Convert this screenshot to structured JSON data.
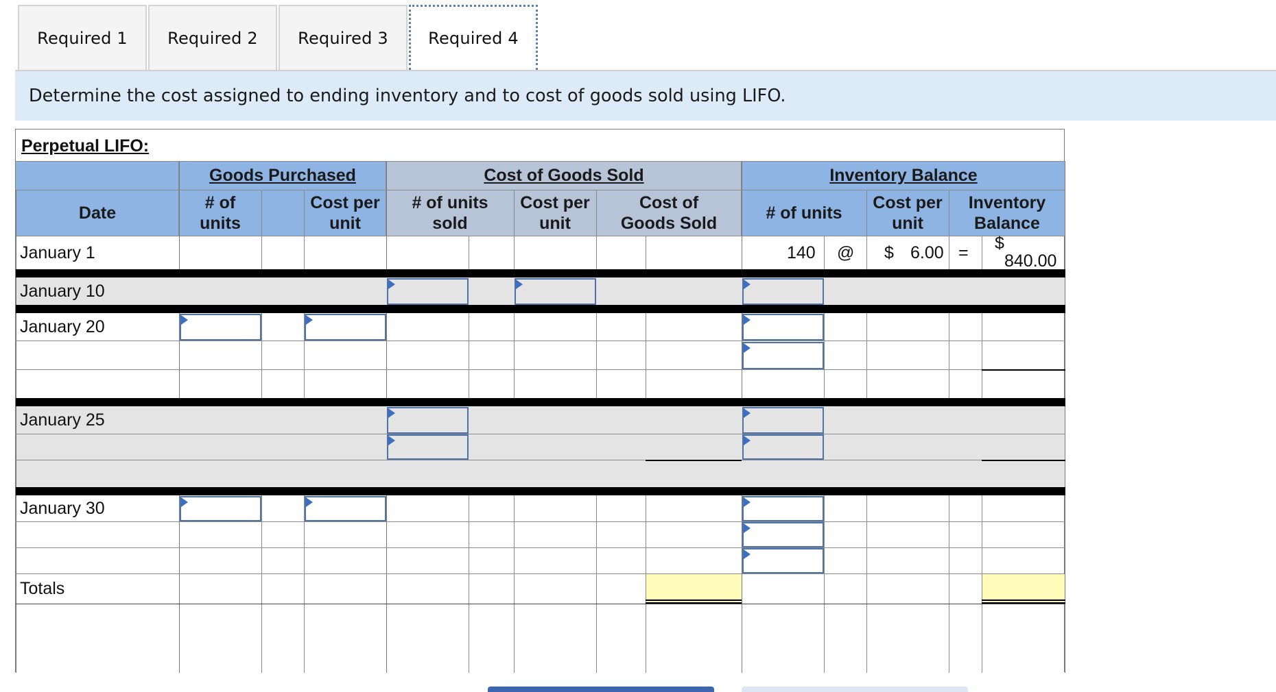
{
  "tabs": [
    {
      "label": "Required 1",
      "active": false
    },
    {
      "label": "Required 2",
      "active": false
    },
    {
      "label": "Required 3",
      "active": false
    },
    {
      "label": "Required 4",
      "active": true
    }
  ],
  "instructions": "Determine the cost assigned to ending inventory and to cost of goods sold using LIFO.",
  "worksheet": {
    "title": "Perpetual LIFO:",
    "groups": {
      "purchased": "Goods Purchased",
      "cogs": "Cost of Goods Sold",
      "balance": "Inventory Balance"
    },
    "columns": {
      "date": "Date",
      "p_units": "# of units",
      "p_cost": "Cost per unit",
      "s_units": "# of units sold",
      "s_cost": "Cost per unit",
      "s_total": "Cost of Goods Sold",
      "b_units": "# of units",
      "b_cost": "Cost per unit",
      "b_total": "Inventory Balance"
    },
    "rows": {
      "jan1": "January 1",
      "jan10": "January 10",
      "jan20": "January 20",
      "jan25": "January 25",
      "jan30": "January 30",
      "totals": "Totals"
    },
    "jan1_balance": {
      "units": "140",
      "at": "@",
      "dollar": "$",
      "cost": "6.00",
      "equals": "=",
      "total_dollar": "$",
      "total": "840.00"
    }
  },
  "colors": {
    "header_blue": "#8eb4e3",
    "header_gray": "#b7c4d8",
    "shaded_row": "#e4e4e4",
    "total_highlight": "#fffbb8",
    "input_border": "#4f73a8"
  }
}
